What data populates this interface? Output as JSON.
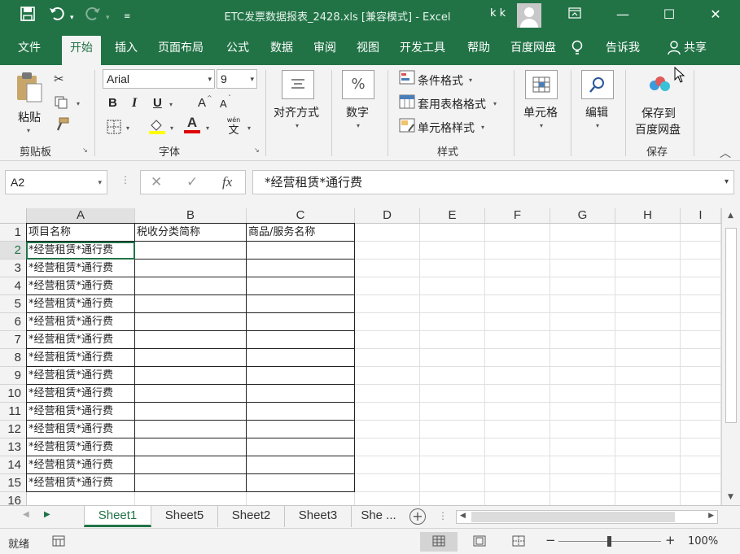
{
  "titlebar": {
    "title": "ETC发票数据报表_2428.xls  [兼容模式]  -  Excel",
    "user": "k k",
    "save_icon": "save-icon",
    "undo_icon": "undo-icon",
    "redo_icon": "redo-icon",
    "customize_icon": "customize-quick-access-icon"
  },
  "menu": {
    "tabs": [
      "文件",
      "开始",
      "插入",
      "页面布局",
      "公式",
      "数据",
      "审阅",
      "视图",
      "开发工具",
      "帮助",
      "百度网盘"
    ],
    "active": "开始",
    "tell_me": "告诉我",
    "share": "共享"
  },
  "ribbon": {
    "clipboard": {
      "paste": "粘贴",
      "label": "剪贴板"
    },
    "font": {
      "name": "Arial",
      "size": "9",
      "bold": "B",
      "italic": "I",
      "underline": "U",
      "grow": "A",
      "shrink": "A",
      "color_letter": "A",
      "phonetic": "wén",
      "phonetic_char": "文",
      "label": "字体"
    },
    "alignment": {
      "label": "对齐方式"
    },
    "number": {
      "label": "数字",
      "icon_glyph": "%"
    },
    "styles": {
      "conditional": "条件格式",
      "table": "套用表格格式",
      "cell": "单元格样式",
      "label": "样式"
    },
    "cells": {
      "label": "单元格"
    },
    "editing": {
      "label": "编辑"
    },
    "save": {
      "line1": "保存到",
      "line2": "百度网盘",
      "label": "保存"
    }
  },
  "formula_bar": {
    "name_box": "A2",
    "fx": "fx",
    "content": "*经营租赁*通行费"
  },
  "columns": [
    "A",
    "B",
    "C",
    "D",
    "E",
    "F",
    "G",
    "H",
    "I"
  ],
  "rows": [
    "1",
    "2",
    "3",
    "4",
    "5",
    "6",
    "7",
    "8",
    "9",
    "10",
    "11",
    "12",
    "13",
    "14",
    "15",
    "16"
  ],
  "table": {
    "headers": [
      "项目名称",
      "税收分类简称",
      "商品/服务名称"
    ],
    "col_a_values": [
      "*经营租赁*通行费",
      "*经营租赁*通行费",
      "*经营租赁*通行费",
      "*经营租赁*通行费",
      "*经营租赁*通行费",
      "*经营租赁*通行费",
      "*经营租赁*通行费",
      "*经营租赁*通行费",
      "*经营租赁*通行费",
      "*经营租赁*通行费",
      "*经营租赁*通行费",
      "*经营租赁*通行费",
      "*经营租赁*通行费",
      "*经营租赁*通行费"
    ]
  },
  "sheets": [
    "Sheet1",
    "Sheet5",
    "Sheet2",
    "Sheet3",
    "She ..."
  ],
  "active_sheet": "Sheet1",
  "status": {
    "ready": "就绪",
    "zoom": "100%",
    "zoom_minus": "−",
    "zoom_plus": "+"
  },
  "colors": {
    "accent": "#217346",
    "ribbon_bg": "#f3f3f3"
  }
}
